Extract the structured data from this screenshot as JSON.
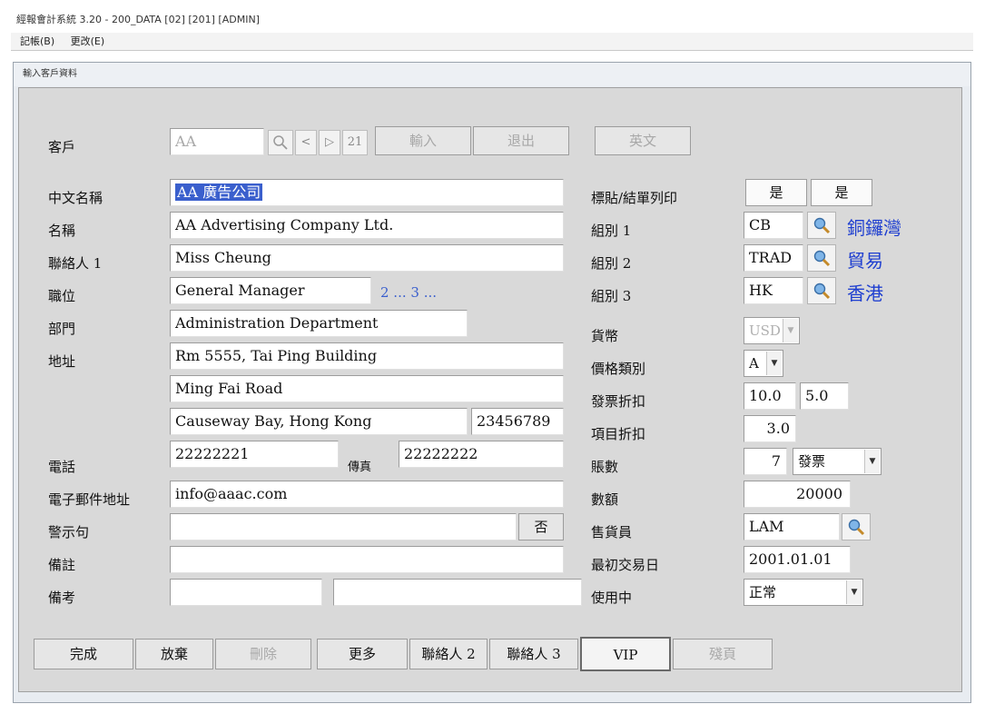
{
  "app": {
    "title": "經報會計系統 3.20 - 200_DATA [02] [201] [ADMIN]",
    "menu": [
      "記帳(B)",
      "更改(E)"
    ],
    "window_title": "輸入客戶資料"
  },
  "toolbar": {
    "customer_label": "客戶",
    "customer_code": "AA",
    "search_icon": "search-icon",
    "page_number": "21",
    "input_label": "輸入",
    "exit_label": "退出",
    "english_label": "英文"
  },
  "left": {
    "chinese_name_label": "中文名稱",
    "chinese_name": "AA 廣告公司",
    "name_label": "名稱",
    "name": "AA Advertising Company Ltd.",
    "contact1_label": "聯絡人 1",
    "contact1": "Miss Cheung",
    "position_label": "職位",
    "position": "General Manager",
    "position_more": "2 ... 3 ...",
    "department_label": "部門",
    "department": "Administration Department",
    "address_label": "地址",
    "address1": "Rm 5555, Tai Ping Building",
    "address2": "Ming Fai Road",
    "address3": "Causeway Bay, Hong Kong",
    "address_code": "23456789",
    "phone_label": "電話",
    "phone": "22222221",
    "fax_label": "傳真",
    "fax": "22222222",
    "email_label": "電子郵件地址",
    "email": "info@aaac.com",
    "warning_label": "警示句",
    "warning": "",
    "warning_toggle": "否",
    "remark_label": "備註",
    "remark": "",
    "memo_label": "備考",
    "memo1": "",
    "memo2": ""
  },
  "right": {
    "label_print_label": "標貼/結單列印",
    "label_print_1": "是",
    "label_print_2": "是",
    "group1_label": "組別 1",
    "group1_code": "CB",
    "group1_name": "銅鑼灣",
    "group2_label": "組別 2",
    "group2_code": "TRAD",
    "group2_name": "貿易",
    "group3_label": "組別 3",
    "group3_code": "HK",
    "group3_name": "香港",
    "currency_label": "貨幣",
    "currency": "USD",
    "price_class_label": "價格類別",
    "price_class": "A",
    "invoice_discount_label": "發票折扣",
    "invoice_discount_1": "10.0",
    "invoice_discount_2": "5.0",
    "item_discount_label": "項目折扣",
    "item_discount": "3.0",
    "days_label": "賬數",
    "days": "7",
    "days_basis": "發票",
    "amount_label": "數額",
    "amount": "20000",
    "salesman_label": "售貨員",
    "salesman": "LAM",
    "first_trade_label": "最初交易日",
    "first_trade": "2001.01.01",
    "in_use_label": "使用中",
    "in_use": "正常"
  },
  "footer": {
    "done": "完成",
    "discard": "放棄",
    "delete": "刪除",
    "more": "更多",
    "contact2": "聯絡人 2",
    "contact3": "聯絡人 3",
    "vip": "VIP",
    "other": "殘頁"
  },
  "colors": {
    "panel": "#d9d9d9",
    "link_blue": "#1f3fd0",
    "highlight": "#3a5fcd"
  }
}
